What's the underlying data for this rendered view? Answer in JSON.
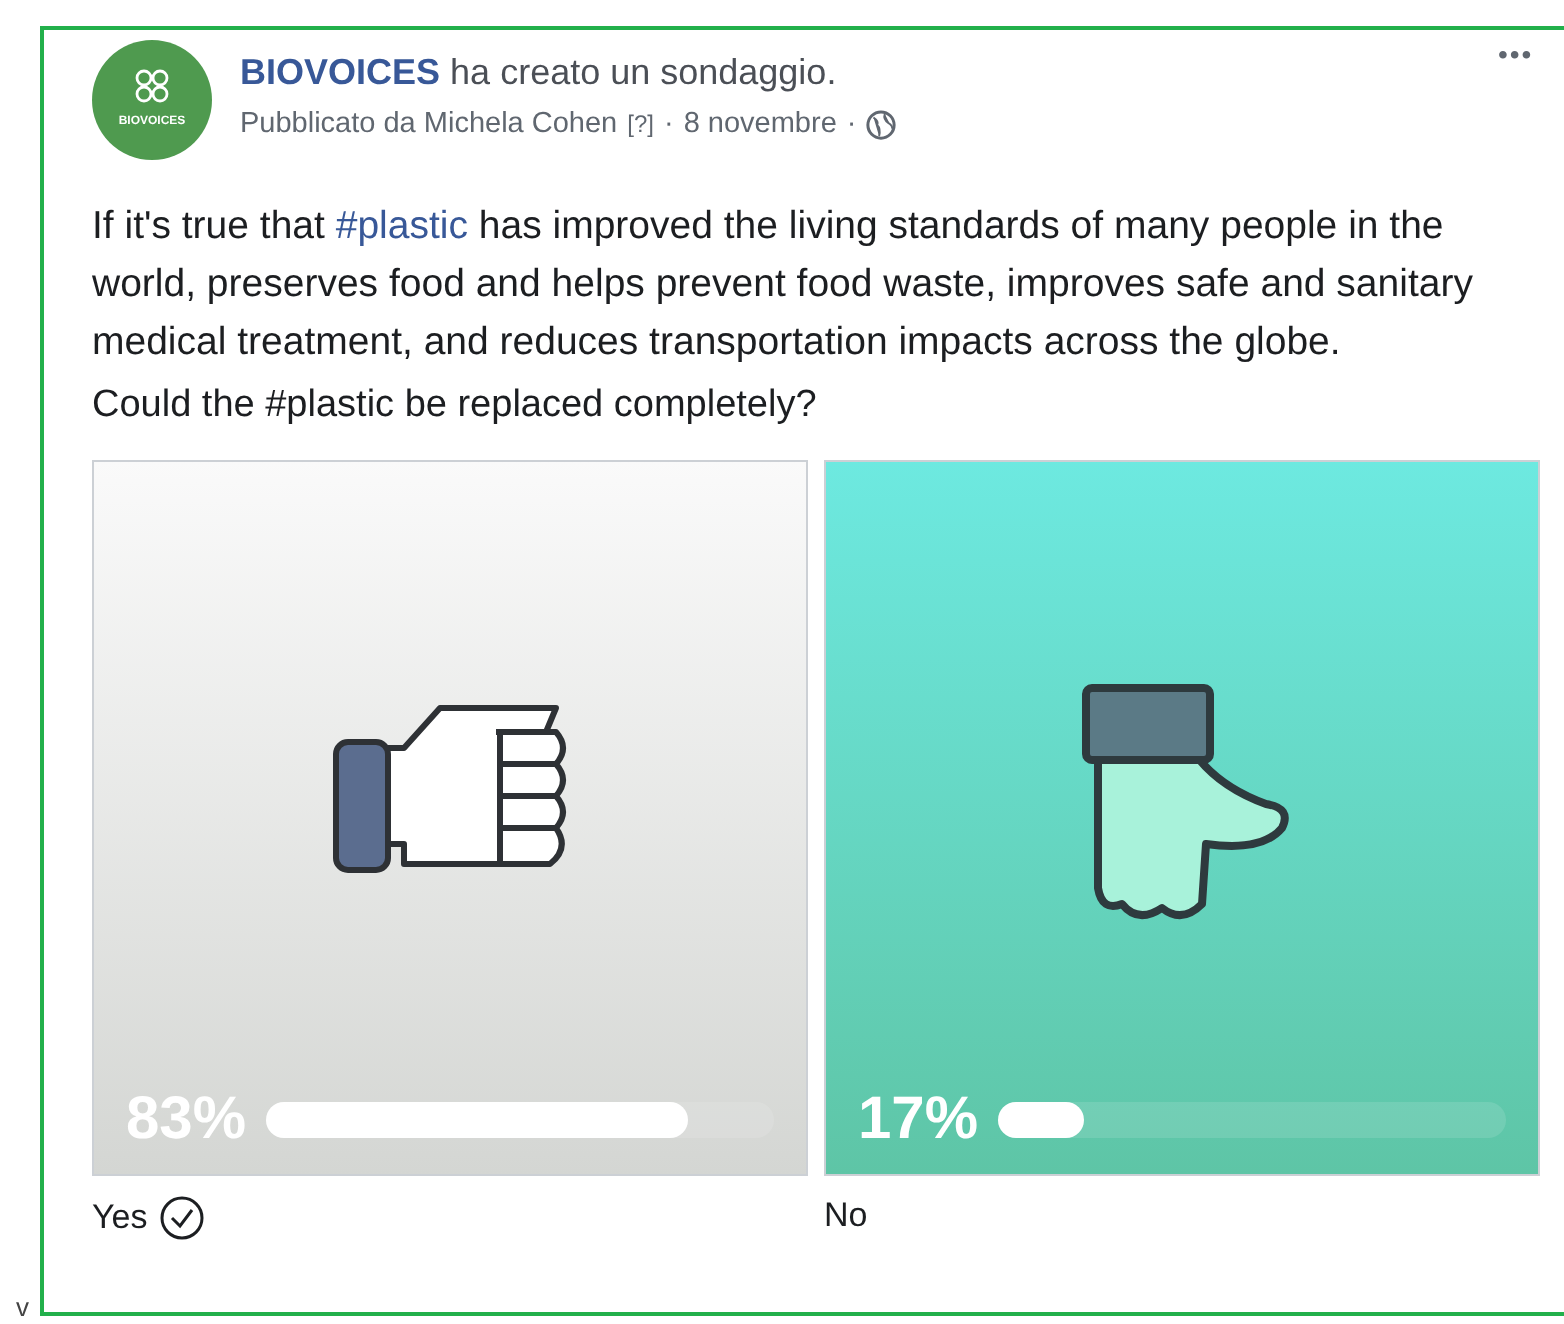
{
  "post": {
    "author": "BIOVOICES",
    "action": "ha creato un sondaggio.",
    "published_by": "Pubblicato da Michela Cohen",
    "help_mark": "[?]",
    "date": "8 novembre",
    "separator_1": "·",
    "separator_2": "·",
    "avatar_text": "BIOVOICES",
    "more": "•••"
  },
  "body": {
    "hashtag": "#plastic",
    "before": "If it's true that ",
    "after": " has improved the living standards of many people in the world, preserves food and helps prevent food waste, improves safe and sanitary medical treatment, and reduces transportation impacts across the globe.",
    "question": "Could the #plastic be replaced completely?"
  },
  "options": [
    {
      "kind": "thumb_side",
      "label": "Yes",
      "percent": "83%",
      "level": 0.83,
      "selected": true
    },
    {
      "kind": "thumb_down",
      "label": "No",
      "percent": "17%",
      "level": 0.17,
      "selected": false
    }
  ],
  "stray_text": "v"
}
